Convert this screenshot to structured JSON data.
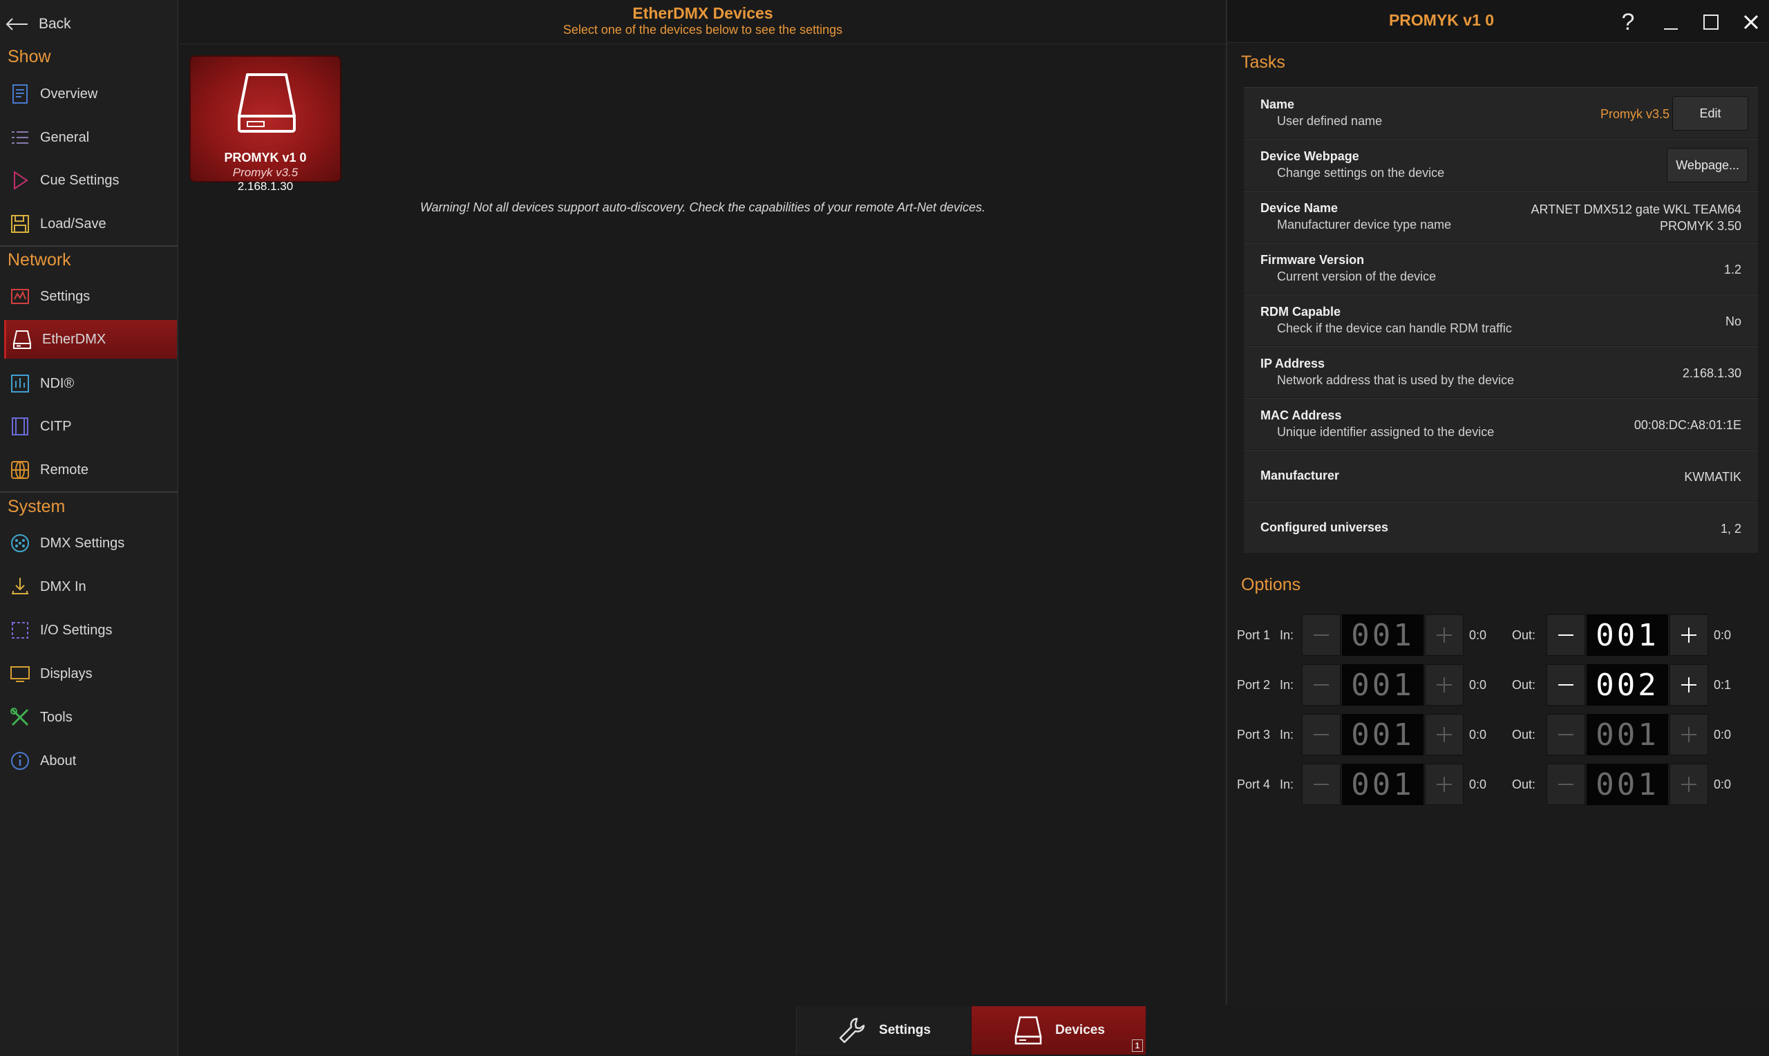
{
  "back_label": "Back",
  "sidebar": {
    "sections": [
      {
        "title": "Show",
        "items": [
          {
            "label": "Overview",
            "icon": "document-icon"
          },
          {
            "label": "General",
            "icon": "list-icon"
          },
          {
            "label": "Cue Settings",
            "icon": "play-icon"
          },
          {
            "label": "Load/Save",
            "icon": "floppy-icon"
          }
        ]
      },
      {
        "title": "Network",
        "items": [
          {
            "label": "Settings",
            "icon": "network-settings-icon"
          },
          {
            "label": "EtherDMX",
            "icon": "etherdmx-icon",
            "active": true
          },
          {
            "label": "NDI®",
            "icon": "ndi-icon"
          },
          {
            "label": "CITP",
            "icon": "film-icon"
          },
          {
            "label": "Remote",
            "icon": "globe-icon"
          }
        ]
      },
      {
        "title": "System",
        "items": [
          {
            "label": "DMX Settings",
            "icon": "dmx-connector-icon"
          },
          {
            "label": "DMX In",
            "icon": "dmx-in-icon"
          },
          {
            "label": "I/O Settings",
            "icon": "io-icon"
          },
          {
            "label": "Displays",
            "icon": "monitor-icon"
          },
          {
            "label": "Tools",
            "icon": "tools-icon"
          },
          {
            "label": "About",
            "icon": "info-icon"
          }
        ]
      }
    ]
  },
  "header": {
    "title": "EtherDMX Devices",
    "subtitle": "Select one of the devices below to see the settings"
  },
  "device_tile": {
    "name": "PROMYK v1 0",
    "subname": "Promyk v3.5",
    "ip": "2.168.1.30"
  },
  "warning": "Warning! Not all devices support auto-discovery. Check the capabilities of your remote Art-Net devices.",
  "panel": {
    "title": "PROMYK v1 0",
    "tasks_title": "Tasks",
    "options_title": "Options",
    "help_label": "?",
    "tasks": [
      {
        "label": "Name",
        "desc": "User defined name",
        "value": "Promyk v3.5",
        "button": "Edit"
      },
      {
        "label": "Device Webpage",
        "desc": "Change settings on the device",
        "button": "Webpage..."
      },
      {
        "label": "Device Name",
        "desc": "Manufacturer device type name",
        "value": "ARTNET DMX512 gate WKL TEAM64",
        "value2": "PROMYK 3.50"
      },
      {
        "label": "Firmware Version",
        "desc": "Current version of the device",
        "value": "1.2"
      },
      {
        "label": "RDM Capable",
        "desc": "Check if the device can handle RDM traffic",
        "value": "No"
      },
      {
        "label": "IP Address",
        "desc": "Network address that is used by the device",
        "value": "2.168.1.30"
      },
      {
        "label": "MAC Address",
        "desc": "Unique identifier assigned to the device",
        "value": "00:08:DC:A8:01:1E"
      },
      {
        "label": "Manufacturer",
        "value": "KWMATIK"
      },
      {
        "label": "Configured universes",
        "value": "1, 2"
      }
    ],
    "in_label": "In:",
    "out_label": "Out:",
    "ports": [
      {
        "label": "Port 1",
        "in": "001",
        "in_sub": "0:0",
        "out": "001",
        "out_sub": "0:0",
        "out_active": true
      },
      {
        "label": "Port 2",
        "in": "001",
        "in_sub": "0:0",
        "out": "002",
        "out_sub": "0:1",
        "out_active": true
      },
      {
        "label": "Port 3",
        "in": "001",
        "in_sub": "0:0",
        "out": "001",
        "out_sub": "0:0",
        "out_active": false
      },
      {
        "label": "Port 4",
        "in": "001",
        "in_sub": "0:0",
        "out": "001",
        "out_sub": "0:0",
        "out_active": false
      }
    ]
  },
  "bottom_tabs": [
    {
      "label": "Settings",
      "icon": "wrench-icon",
      "active": false
    },
    {
      "label": "Devices",
      "icon": "device-icon",
      "active": true,
      "badge": "1"
    }
  ],
  "colors": {
    "accent": "#e8973a",
    "active_red": "#8a1616",
    "background": "#1b1b1b"
  }
}
